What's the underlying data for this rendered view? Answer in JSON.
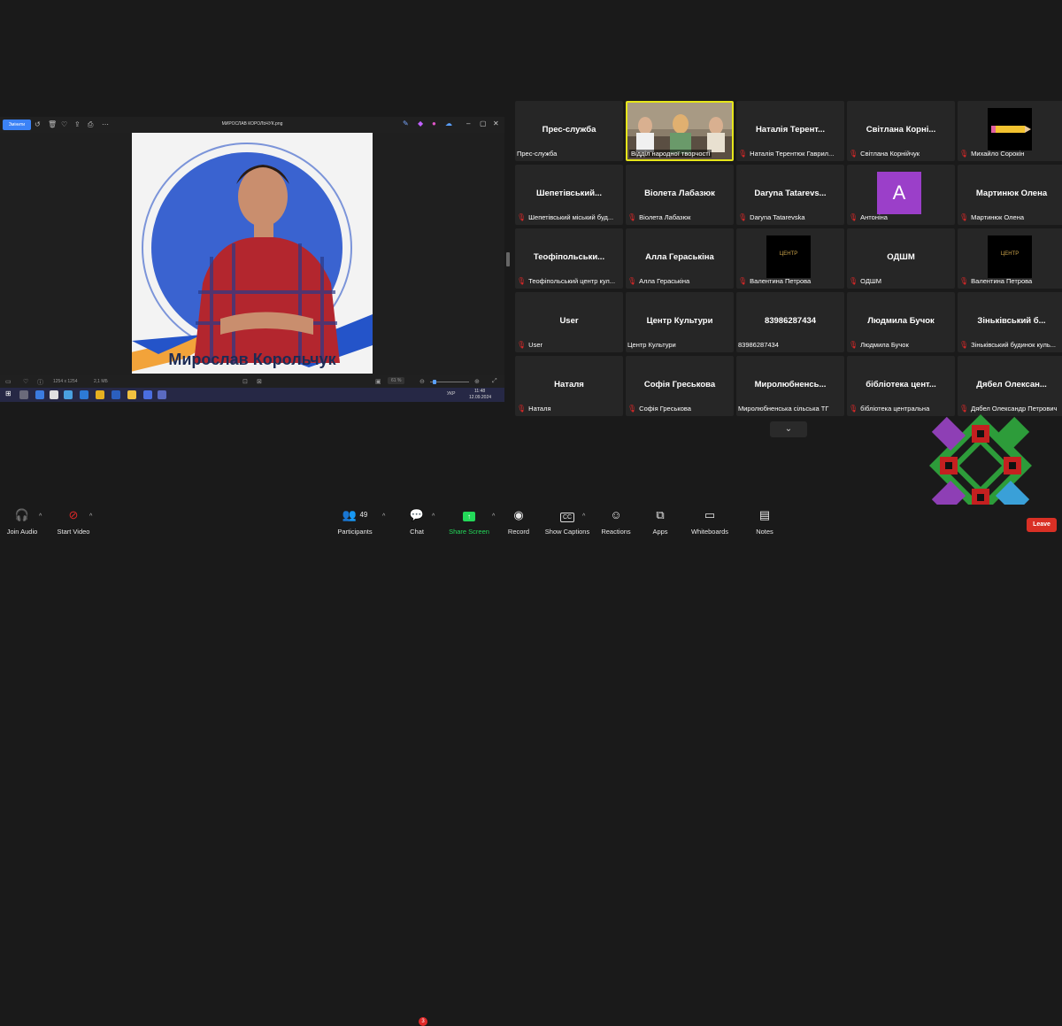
{
  "shared_screen": {
    "edit_button": "Змінити",
    "file_name": "МИРОСЛАВ КОРОЛЬЧУК.png",
    "photo_caption": "Мирослав Корольчук",
    "status": {
      "dimensions": "1254 x 1254",
      "size": "2,1 МБ",
      "zoom": "61 %"
    },
    "taskbar": {
      "lang": "УКР",
      "time": "11:48",
      "date": "12.09.2024"
    }
  },
  "gallery": {
    "tiles": [
      {
        "title": "Прес-служба",
        "name": "Прес-служба",
        "muted": false
      },
      {
        "title": "",
        "name": "Відділ народної творчості",
        "muted": false,
        "video": true
      },
      {
        "title": "Наталія Терент...",
        "name": "Наталія Терентюк Гаврил...",
        "muted": true
      },
      {
        "title": "Світлана Корні...",
        "name": "Світлана Корнійчук",
        "muted": true
      },
      {
        "title": "",
        "name": "Михайло Сорокін",
        "muted": true,
        "avatar": "pencil-image"
      },
      {
        "title": "Шепетівський...",
        "name": "Шепетівський міський буд...",
        "muted": true
      },
      {
        "title": "Віолета Лабазюк",
        "name": "Віолета Лабазюк",
        "muted": true
      },
      {
        "title": "Daryna Tatarevs...",
        "name": "Daryna Tatarevska",
        "muted": true
      },
      {
        "title": "",
        "name": "Антоніна",
        "muted": true,
        "avatar_letter": "A"
      },
      {
        "title": "Мартинюк Олена",
        "name": "Мартинюк Олена",
        "muted": true
      },
      {
        "title": "Теофіпольськи...",
        "name": "Теофіпольський центр кул...",
        "muted": true
      },
      {
        "title": "Алла Гераськіна",
        "name": "Алла Гераськіна",
        "muted": true
      },
      {
        "title": "",
        "name": "Валентина Петрова",
        "muted": true,
        "avatar": "logo"
      },
      {
        "title": "ОДШМ",
        "name": "ОДШМ",
        "muted": true
      },
      {
        "title": "",
        "name": "Валентина Петрова",
        "muted": true,
        "avatar": "logo"
      },
      {
        "title": "User",
        "name": "User",
        "muted": true
      },
      {
        "title": "Центр Культури",
        "name": "Центр Культури",
        "muted": false
      },
      {
        "title": "83986287434",
        "name": "83986287434",
        "muted": false
      },
      {
        "title": "Людмила Бучок",
        "name": "Людмила Бучок",
        "muted": true
      },
      {
        "title": "Зіньківський б...",
        "name": "Зіньківський будинок куль...",
        "muted": true
      },
      {
        "title": "Наталя",
        "name": "Наталя",
        "muted": true
      },
      {
        "title": "Софія Греськова",
        "name": "Софія Греськова",
        "muted": true
      },
      {
        "title": "Миролюбненсь...",
        "name": "Миролюбненська сільська ТГ",
        "muted": false
      },
      {
        "title": "бібліотека цент...",
        "name": "бібліотека центральна",
        "muted": true
      },
      {
        "title": "Дябел Олексан...",
        "name": "Дябел Олександр Петрович",
        "muted": true
      }
    ],
    "logo_text": "ЦЕНТР"
  },
  "toolbar": {
    "join_audio": "Join Audio",
    "start_video": "Start Video",
    "participants": "Participants",
    "participants_count": "49",
    "chat": "Chat",
    "chat_badge": "3",
    "share_screen": "Share Screen",
    "record": "Record",
    "show_captions": "Show Captions",
    "reactions": "Reactions",
    "apps": "Apps",
    "whiteboards": "Whiteboards",
    "notes": "Notes",
    "leave": "Leave"
  },
  "colors": {
    "accent_green": "#23d959",
    "leave_red": "#d93025",
    "active_speaker": "#e6e61a",
    "avatar_purple": "#9b3fc9"
  }
}
